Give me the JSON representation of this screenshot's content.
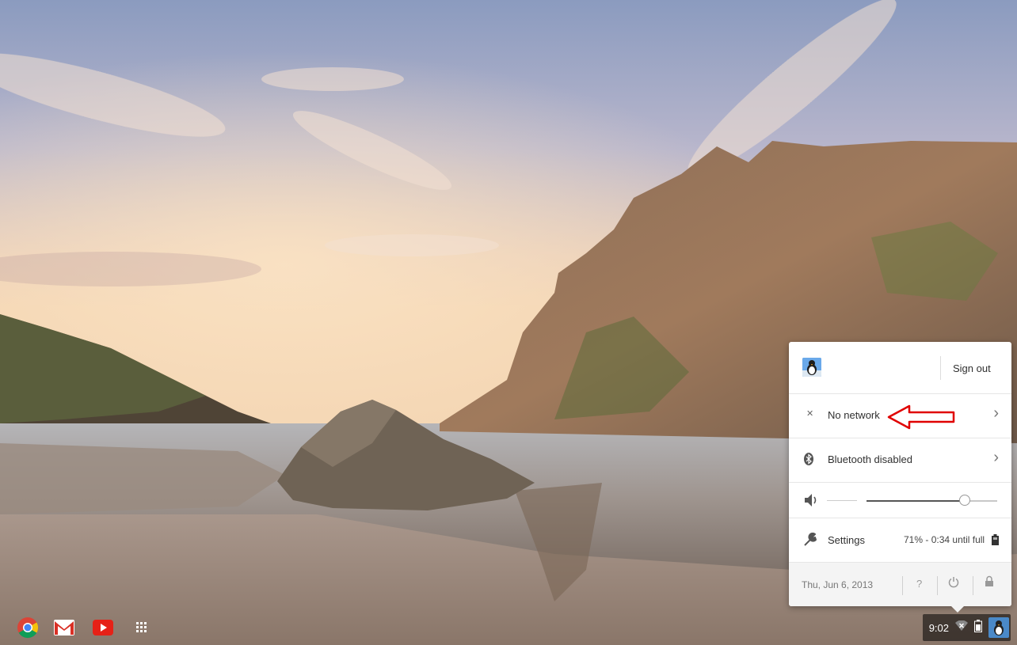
{
  "shelf": {
    "apps": [
      {
        "name": "Chrome",
        "icon": "chrome-icon"
      },
      {
        "name": "Gmail",
        "icon": "gmail-icon"
      },
      {
        "name": "YouTube",
        "icon": "youtube-icon"
      },
      {
        "name": "Apps",
        "icon": "app-launcher-icon"
      }
    ],
    "status": {
      "time": "9:02",
      "network_icon": "no-network-icon",
      "battery_icon": "battery-icon",
      "avatar_icon": "user-avatar-icon"
    }
  },
  "tray": {
    "sign_out_label": "Sign out",
    "network": {
      "label": "No network",
      "icon": "no-network-icon"
    },
    "bluetooth": {
      "label": "Bluetooth disabled",
      "icon": "bluetooth-icon"
    },
    "volume": {
      "icon": "speaker-icon",
      "level": 0.75
    },
    "settings": {
      "label": "Settings",
      "icon": "wrench-icon"
    },
    "battery": {
      "percent": "71%",
      "separator": " - ",
      "time": "0:34 until full"
    },
    "date": "Thu, Jun 6, 2013",
    "footer_buttons": {
      "help": "?",
      "power_icon": "power-icon",
      "lock_icon": "lock-icon"
    }
  },
  "annotation": {
    "color": "#e00000",
    "points_to": "No network"
  },
  "colors": {
    "accent": "#4a89c8",
    "tray_bg": "#ffffff",
    "footer_bg": "#f4f4f4"
  }
}
